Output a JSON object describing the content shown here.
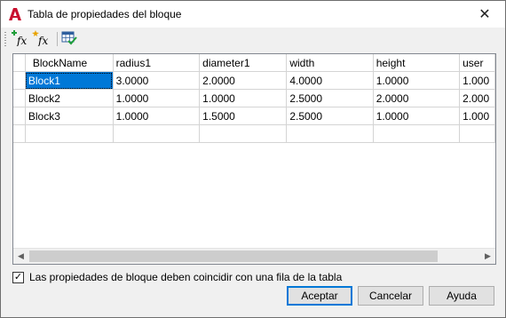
{
  "window": {
    "title": "Tabla de propiedades del bloque",
    "close_glyph": "✕"
  },
  "toolbar": {
    "buttons": [
      {
        "icon": "add-parameter-property-icon",
        "text": "fx"
      },
      {
        "icon": "add-user-property-icon",
        "text": "fx"
      },
      {
        "icon": "audit-table-icon"
      }
    ]
  },
  "grid": {
    "columns": [
      "BlockName",
      "radius1",
      "diameter1",
      "width",
      "height",
      "user"
    ],
    "rows": [
      [
        "Block1",
        "3.0000",
        "2.0000",
        "4.0000",
        "1.0000",
        "1.000"
      ],
      [
        "Block2",
        "1.0000",
        "1.0000",
        "2.5000",
        "2.0000",
        "2.000"
      ],
      [
        "Block3",
        "1.0000",
        "1.5000",
        "2.5000",
        "1.0000",
        "1.000"
      ],
      [
        "",
        "",
        "",
        "",
        "",
        ""
      ]
    ],
    "selected_cell": "Block1"
  },
  "scrollbar": {
    "left_glyph": "◀",
    "right_glyph": "▶"
  },
  "options": {
    "must_match_checkbox": {
      "checked": true,
      "label": "Las propiedades de bloque deben coincidir con una fila de la tabla",
      "glyph": "✓"
    }
  },
  "buttons": {
    "ok": "Aceptar",
    "cancel": "Cancelar",
    "help": "Ayuda"
  },
  "colors": {
    "selection": "#0078d7",
    "accent_red": "#c8102e"
  }
}
